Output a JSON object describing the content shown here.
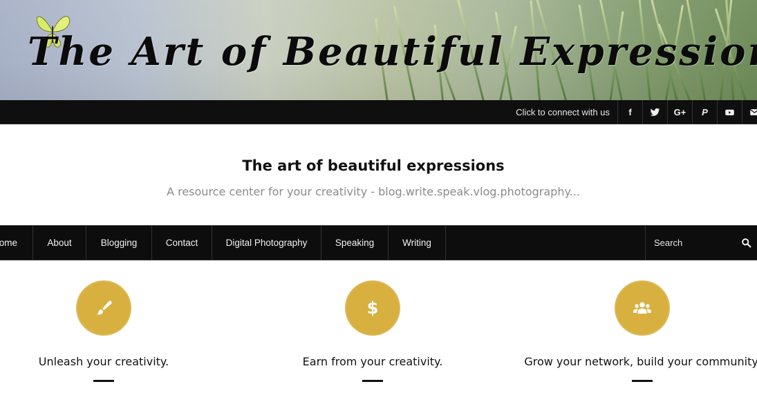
{
  "banner": {
    "title": "The Art of Beautiful Expressions"
  },
  "topbar": {
    "connect_text": "Click to connect with us",
    "social": [
      {
        "icon": "facebook-icon",
        "glyph": "f"
      },
      {
        "icon": "twitter-icon",
        "glyph": ""
      },
      {
        "icon": "google-plus-icon",
        "glyph": "G+"
      },
      {
        "icon": "paypal-icon",
        "glyph": "P"
      },
      {
        "icon": "youtube-icon",
        "glyph": ""
      },
      {
        "icon": "email-icon",
        "glyph": ""
      }
    ]
  },
  "site": {
    "title": "The art of beautiful expressions",
    "tagline": "A resource center for your creativity - blog.write.speak.vlog.photography..."
  },
  "nav": {
    "items": [
      {
        "label": "Home"
      },
      {
        "label": "About"
      },
      {
        "label": "Blogging"
      },
      {
        "label": "Contact"
      },
      {
        "label": "Digital Photography"
      },
      {
        "label": "Speaking"
      },
      {
        "label": "Writing"
      }
    ],
    "search_placeholder": "Search"
  },
  "features": [
    {
      "icon": "paintbrush-icon",
      "title": "Unleash your creativity."
    },
    {
      "icon": "dollar-icon",
      "title": "Earn from your creativity."
    },
    {
      "icon": "users-icon",
      "title": "Grow your network, build your community."
    }
  ],
  "colors": {
    "accent": "#d8b040",
    "dark_bar": "#0d0d0d"
  }
}
